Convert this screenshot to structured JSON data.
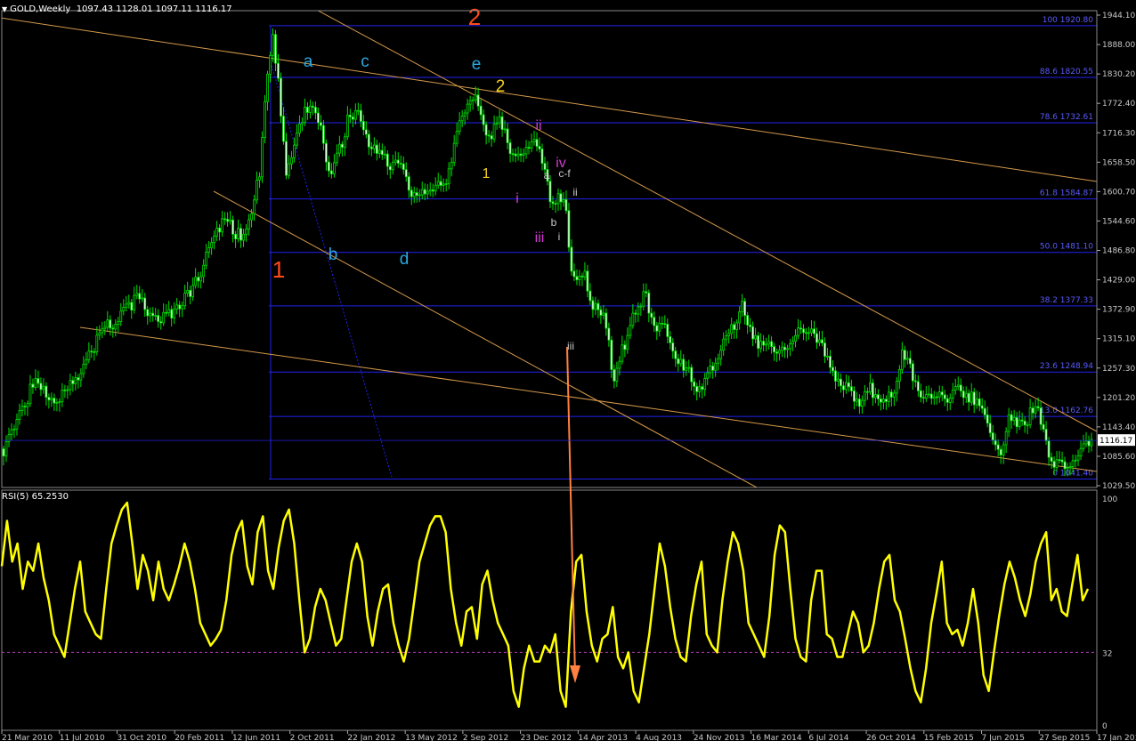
{
  "header": {
    "symbol": "GOLD,Weekly",
    "ohlc": "1097.43 1128.01 1097.11 1116.17"
  },
  "rsi_header": {
    "label": "RSI(5) 65.2530"
  },
  "colors": {
    "background": "#000000",
    "candle": "#00e000",
    "fib_line": "#2222ee",
    "fib_label": "#5a5aff",
    "trend_line": "#d4994a",
    "rsi_line": "#ffff00",
    "rsi_level": "#b03cb0",
    "arrow": "#ff8040",
    "axis_text": "#c8c8c8",
    "wave_orange": "#ff4a1a",
    "wave_blue": "#29a8e0",
    "wave_yellow": "#f5d020",
    "wave_magenta": "#d23cd2",
    "wave_gray": "#c8c8c8"
  },
  "chart_data": [
    {
      "type": "candlestick",
      "name": "GOLD,Weekly",
      "ylim": [
        1025,
        1950
      ],
      "y_ticks": [
        "1944.10",
        "1888.00",
        "1830.20",
        "1772.40",
        "1716.30",
        "1658.50",
        "1600.70",
        "1544.60",
        "1486.80",
        "1429.00",
        "1372.90",
        "1315.10",
        "1257.30",
        "1201.20",
        "1143.40",
        "1085.60",
        "1029.50"
      ],
      "x_ticks": [
        "21 Mar 2010",
        "11 Jul 2010",
        "31 Oct 2010",
        "20 Feb 2011",
        "12 Jun 2011",
        "2 Oct 2011",
        "22 Jan 2012",
        "13 May 2012",
        "2 Sep 2012",
        "23 Dec 2012",
        "14 Apr 2013",
        "4 Aug 2013",
        "24 Nov 2013",
        "16 Mar 2014",
        "6 Jul 2014",
        "26 Oct 2014",
        "15 Feb 2015",
        "7 Jun 2015",
        "27 Sep 2015",
        "17 Jan 2016"
      ],
      "current_price": "1116.17",
      "close_path": [
        [
          0,
          1100
        ],
        [
          10,
          1140
        ],
        [
          22,
          1185
        ],
        [
          34,
          1225
        ],
        [
          48,
          1210
        ],
        [
          58,
          1195
        ],
        [
          75,
          1230
        ],
        [
          90,
          1255
        ],
        [
          102,
          1300
        ],
        [
          113,
          1335
        ],
        [
          125,
          1345
        ],
        [
          137,
          1370
        ],
        [
          150,
          1390
        ],
        [
          162,
          1370
        ],
        [
          175,
          1345
        ],
        [
          187,
          1360
        ],
        [
          200,
          1385
        ],
        [
          212,
          1405
        ],
        [
          222,
          1440
        ],
        [
          235,
          1510
        ],
        [
          248,
          1545
        ],
        [
          258,
          1525
        ],
        [
          268,
          1510
        ],
        [
          278,
          1555
        ],
        [
          288,
          1635
        ],
        [
          297,
          1840
        ],
        [
          303,
          1905
        ],
        [
          310,
          1790
        ],
        [
          318,
          1620
        ],
        [
          328,
          1690
        ],
        [
          338,
          1750
        ],
        [
          348,
          1770
        ],
        [
          358,
          1715
        ],
        [
          368,
          1620
        ],
        [
          378,
          1680
        ],
        [
          388,
          1740
        ],
        [
          398,
          1755
        ],
        [
          408,
          1700
        ],
        [
          418,
          1680
        ],
        [
          428,
          1665
        ],
        [
          438,
          1650
        ],
        [
          448,
          1645
        ],
        [
          458,
          1600
        ],
        [
          468,
          1595
        ],
        [
          478,
          1595
        ],
        [
          488,
          1605
        ],
        [
          498,
          1620
        ],
        [
          508,
          1690
        ],
        [
          518,
          1760
        ],
        [
          528,
          1790
        ],
        [
          538,
          1740
        ],
        [
          548,
          1705
        ],
        [
          558,
          1740
        ],
        [
          568,
          1690
        ],
        [
          578,
          1665
        ],
        [
          588,
          1680
        ],
        [
          598,
          1690
        ],
        [
          608,
          1650
        ],
        [
          616,
          1570
        ],
        [
          624,
          1600
        ],
        [
          632,
          1570
        ],
        [
          638,
          1440
        ],
        [
          644,
          1420
        ],
        [
          652,
          1450
        ],
        [
          660,
          1380
        ],
        [
          670,
          1380
        ],
        [
          680,
          1330
        ],
        [
          686,
          1230
        ],
        [
          694,
          1280
        ],
        [
          704,
          1320
        ],
        [
          712,
          1380
        ],
        [
          722,
          1400
        ],
        [
          732,
          1340
        ],
        [
          742,
          1340
        ],
        [
          752,
          1300
        ],
        [
          762,
          1260
        ],
        [
          772,
          1250
        ],
        [
          782,
          1215
        ],
        [
          792,
          1250
        ],
        [
          802,
          1270
        ],
        [
          812,
          1320
        ],
        [
          822,
          1345
        ],
        [
          832,
          1385
        ],
        [
          842,
          1320
        ],
        [
          852,
          1300
        ],
        [
          862,
          1305
        ],
        [
          872,
          1295
        ],
        [
          882,
          1305
        ],
        [
          892,
          1320
        ],
        [
          902,
          1335
        ],
        [
          912,
          1315
        ],
        [
          922,
          1290
        ],
        [
          932,
          1250
        ],
        [
          942,
          1225
        ],
        [
          952,
          1215
        ],
        [
          962,
          1185
        ],
        [
          972,
          1220
        ],
        [
          982,
          1200
        ],
        [
          992,
          1200
        ],
        [
          1002,
          1220
        ],
        [
          1012,
          1290
        ],
        [
          1022,
          1250
        ],
        [
          1032,
          1195
        ],
        [
          1042,
          1195
        ],
        [
          1052,
          1210
        ],
        [
          1062,
          1200
        ],
        [
          1072,
          1215
        ],
        [
          1082,
          1205
        ],
        [
          1092,
          1195
        ],
        [
          1102,
          1170
        ],
        [
          1112,
          1110
        ],
        [
          1122,
          1100
        ],
        [
          1132,
          1170
        ],
        [
          1142,
          1140
        ],
        [
          1152,
          1160
        ],
        [
          1162,
          1180
        ],
        [
          1172,
          1110
        ],
        [
          1182,
          1070
        ],
        [
          1192,
          1065
        ],
        [
          1202,
          1075
        ],
        [
          1212,
          1090
        ],
        [
          1224,
          1116
        ]
      ]
    },
    {
      "type": "fibonacci",
      "levels": [
        {
          "ratio": "100",
          "price": "1920.80",
          "text": "100 1920.80"
        },
        {
          "ratio": "88.6",
          "price": "1820.55",
          "text": "88.6 1820.55"
        },
        {
          "ratio": "78.6",
          "price": "1732.61",
          "text": "78.6 1732.61"
        },
        {
          "ratio": "61.8",
          "price": "1584.87",
          "text": "61.8 1584.87"
        },
        {
          "ratio": "50.0",
          "price": "1481.10",
          "text": "50.0 1481.10"
        },
        {
          "ratio": "38.2",
          "price": "1377.33",
          "text": "38.2 1377.33"
        },
        {
          "ratio": "23.6",
          "price": "1248.94",
          "text": "23.6 1248.94"
        },
        {
          "ratio": "13.0",
          "price": "1162.76",
          "text": "13.0 1162.76"
        },
        {
          "ratio": "0",
          "price": "1041.40",
          "text": "0 1041.40"
        }
      ]
    },
    {
      "type": "annotations",
      "wave_labels": [
        {
          "text": "2",
          "color": "orange",
          "size": "xl"
        },
        {
          "text": "1",
          "color": "orange",
          "size": "xl"
        },
        {
          "text": "a",
          "color": "blue",
          "size": "l"
        },
        {
          "text": "b",
          "color": "blue",
          "size": "l"
        },
        {
          "text": "c",
          "color": "blue",
          "size": "l"
        },
        {
          "text": "d",
          "color": "blue",
          "size": "l"
        },
        {
          "text": "e",
          "color": "blue",
          "size": "l"
        },
        {
          "text": "2",
          "color": "yellow",
          "size": "l"
        },
        {
          "text": "1",
          "color": "yellow",
          "size": "m"
        },
        {
          "text": "ii",
          "color": "magenta",
          "size": "m"
        },
        {
          "text": "iv",
          "color": "magenta",
          "size": "m"
        },
        {
          "text": "i",
          "color": "magenta",
          "size": "m"
        },
        {
          "text": "iii",
          "color": "magenta",
          "size": "m"
        },
        {
          "text": "a",
          "color": "gray",
          "size": "s"
        },
        {
          "text": "c-f",
          "color": "gray",
          "size": "s"
        },
        {
          "text": "ii",
          "color": "gray",
          "size": "s"
        },
        {
          "text": "b",
          "color": "gray",
          "size": "s"
        },
        {
          "text": "i",
          "color": "gray",
          "size": "s"
        },
        {
          "text": "iii",
          "color": "gray",
          "size": "s"
        }
      ]
    },
    {
      "type": "line",
      "name": "RSI(5) 65.2530",
      "ylim": [
        0,
        100
      ],
      "y_ticks": [
        "100",
        "32",
        "0"
      ],
      "level": 32,
      "values": [
        70,
        90,
        72,
        80,
        60,
        72,
        68,
        80,
        65,
        55,
        40,
        35,
        30,
        45,
        60,
        72,
        50,
        45,
        40,
        38,
        60,
        80,
        88,
        95,
        98,
        80,
        60,
        75,
        68,
        55,
        72,
        60,
        55,
        62,
        70,
        80,
        72,
        60,
        45,
        40,
        35,
        38,
        42,
        55,
        75,
        85,
        90,
        70,
        62,
        85,
        92,
        68,
        60,
        78,
        90,
        95,
        80,
        55,
        32,
        38,
        52,
        60,
        55,
        45,
        35,
        38,
        55,
        72,
        80,
        72,
        48,
        35,
        50,
        60,
        62,
        45,
        35,
        28,
        38,
        55,
        72,
        80,
        88,
        92,
        92,
        85,
        60,
        45,
        35,
        50,
        52,
        38,
        62,
        68,
        55,
        45,
        40,
        35,
        15,
        8,
        25,
        35,
        28,
        28,
        35,
        32,
        40,
        15,
        8,
        50,
        72,
        75,
        50,
        35,
        28,
        38,
        40,
        52,
        30,
        25,
        32,
        15,
        10,
        25,
        40,
        60,
        80,
        70,
        52,
        38,
        30,
        28,
        48,
        62,
        72,
        40,
        35,
        32,
        55,
        72,
        85,
        80,
        68,
        45,
        40,
        35,
        30,
        48,
        75,
        88,
        85,
        60,
        38,
        30,
        28,
        55,
        68,
        68,
        40,
        38,
        30,
        30,
        40,
        50,
        45,
        32,
        35,
        45,
        60,
        72,
        75,
        55,
        50,
        38,
        25,
        15,
        10,
        25,
        45,
        58,
        72,
        45,
        40,
        42,
        35,
        45,
        60,
        45,
        22,
        15,
        32,
        48,
        62,
        72,
        65,
        55,
        48,
        58,
        72,
        80,
        85,
        55,
        60,
        50,
        48,
        62,
        75,
        55,
        60
      ]
    }
  ]
}
